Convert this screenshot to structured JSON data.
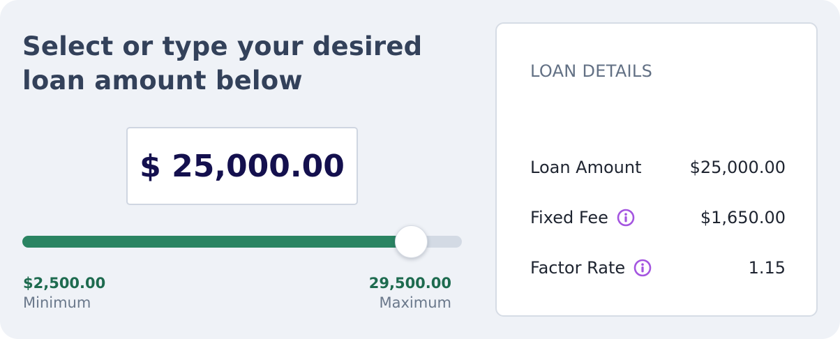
{
  "heading": "Select or type your desired loan amount below",
  "amount_input": {
    "value": "$ 25,000.00"
  },
  "slider": {
    "value_fraction": 0.8846,
    "min_value": "$2,500.00",
    "min_caption": "Minimum",
    "max_value": "29,500.00",
    "max_caption": "Maximum"
  },
  "loan_details": {
    "title": "LOAN DETAILS",
    "rows": [
      {
        "label": "Loan Amount",
        "value": "$25,000.00",
        "icon": null
      },
      {
        "label": "Fixed Fee",
        "value": "$1,650.00",
        "icon": "info-icon"
      },
      {
        "label": "Factor Rate",
        "value": "1.15",
        "icon": "info-icon"
      }
    ]
  },
  "colors": {
    "card_bg": "#eff2f7",
    "slider_fill": "#2a8462",
    "slider_track": "#d3dae4",
    "amount_text": "#14104e",
    "info_icon": "#a455e0"
  }
}
